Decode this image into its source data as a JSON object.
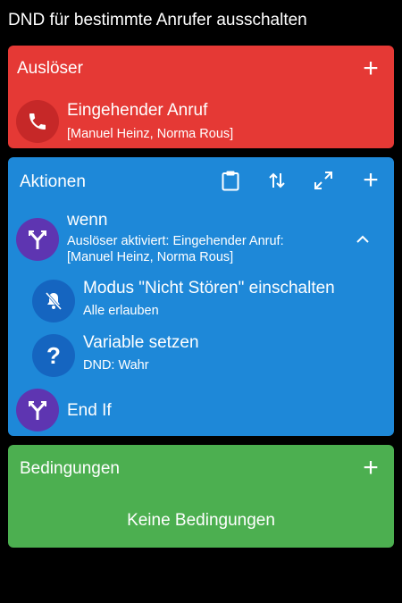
{
  "header": {
    "title": "DND für bestimmte Anrufer ausschalten"
  },
  "trigger_section": {
    "title": "Auslöser",
    "item": {
      "title": "Eingehender Anruf",
      "detail": "[Manuel Heinz, Norma Rous]"
    }
  },
  "actions_section": {
    "title": "Aktionen",
    "items": [
      {
        "title": "wenn",
        "detail_1": "Auslöser aktiviert: Eingehender Anruf:",
        "detail_2": "[Manuel Heinz, Norma Rous]"
      },
      {
        "title": "Modus \"Nicht Stören\" einschalten",
        "detail": "Alle erlauben"
      },
      {
        "title": "Variable setzen",
        "detail": "DND: Wahr"
      },
      {
        "title": "End If"
      }
    ]
  },
  "conditions_section": {
    "title": "Bedingungen",
    "empty_text": "Keine Bedingungen"
  },
  "colors": {
    "trigger": "#e53935",
    "actions": "#1e88d8",
    "conditions": "#4caf50",
    "logic_icon": "#5e35b1"
  },
  "icons": [
    "phone-icon",
    "clipboard-icon",
    "swap-icon",
    "expand-icon",
    "add-icon",
    "if-branch-icon",
    "chevron-up-icon",
    "dnd-off-icon",
    "question-icon"
  ]
}
